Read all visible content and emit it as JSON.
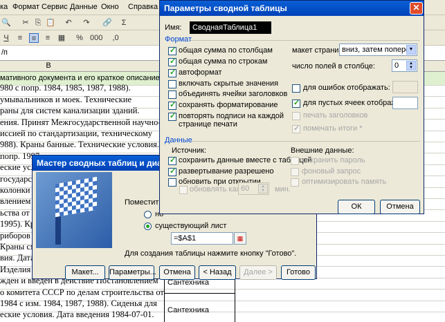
{
  "excel": {
    "menu": [
      "рка",
      "Формат",
      "Сервис",
      "Данные",
      "Окно",
      "Справка"
    ],
    "formula_value": "/п",
    "column_header": "B",
    "rows": [
      "мативного документа и его краткое описание",
      "980 с попр. 1984, 1985, 1987, 1988).",
      "умывальников и моек. Технические",
      "раны для систем канализации зданий.",
      "ения. Принят Межгосударственной научно-",
      "иссией по стандартизации, техническому",
      "988). Краны банные. Технические условия.",
      "попр. 1997",
      "еские усл",
      "государс",
      "колонки во",
      "влением",
      "ьства от",
      "1995). Кр",
      "риборов",
      "Краны см",
      "вия. Дата",
      "Изделия с",
      "жден и введен в действие Постановлением",
      "о комитета СССР по делам строительства от",
      "1984 с изм. 1984, 1987, 1988). Сиденья для",
      "еские условия. Дата введения 1984-07-01."
    ],
    "cells": {
      "c1": "Сантехника",
      "c2": "Сантехника"
    }
  },
  "wizard": {
    "title": "Мастер сводных таблиц и диаграмм",
    "place_label": "Поместить т",
    "option_new": "но",
    "option_existing": "существующий лист",
    "range_value": "=$A$1",
    "hint": "Для создания таблицы нажмите кнопку \"Готово\".",
    "buttons": {
      "layout": "Макет...",
      "params": "Параметры...",
      "cancel": "Отмена",
      "back": "< Назад",
      "next": "Далее >",
      "finish": "Готово"
    }
  },
  "params": {
    "title": "Параметры сводной таблицы",
    "name_label": "Имя:",
    "name_value": "СводнаяТаблица1",
    "format_section": "Формат",
    "format_left": [
      {
        "label": "общая сумма по столбцам",
        "checked": true
      },
      {
        "label": "общая сумма по строкам",
        "checked": true
      },
      {
        "label": "автоформат",
        "checked": true
      },
      {
        "label": "включать скрытые значения",
        "checked": false
      },
      {
        "label": "объединять ячейки заголовков",
        "checked": false
      },
      {
        "label": "сохранять форматирование",
        "checked": true
      },
      {
        "label": "повторять подписи на каждой",
        "label2": "странице печати",
        "checked": true
      }
    ],
    "layout_label": "макет страницы:",
    "layout_value": "вниз, затем поперек",
    "fields_label": "число полей в столбце:",
    "fields_value": "0",
    "errors_label": "для ошибок отображать:",
    "errors_checked": false,
    "empty_label": "для пустых ячеек отображать:",
    "empty_checked": true,
    "print_titles_label": "печать заголовков",
    "mark_totals_label": "помечать итоги *",
    "data_section": "Данные",
    "source_label": "Источник:",
    "source": [
      {
        "label": "сохранить данные вместе с таблицей",
        "checked": true
      },
      {
        "label": "развертывание разрешено",
        "checked": true
      },
      {
        "label": "обновить при открытии",
        "checked": false
      }
    ],
    "refresh_label": "обновлять каждые",
    "refresh_value": "60",
    "refresh_unit": "мин.",
    "external_label": "Внешние данные:",
    "external": [
      "сохранить пароль",
      "фоновый запрос",
      "оптимизировать память"
    ],
    "ok": "ОК",
    "cancel": "Отмена"
  }
}
